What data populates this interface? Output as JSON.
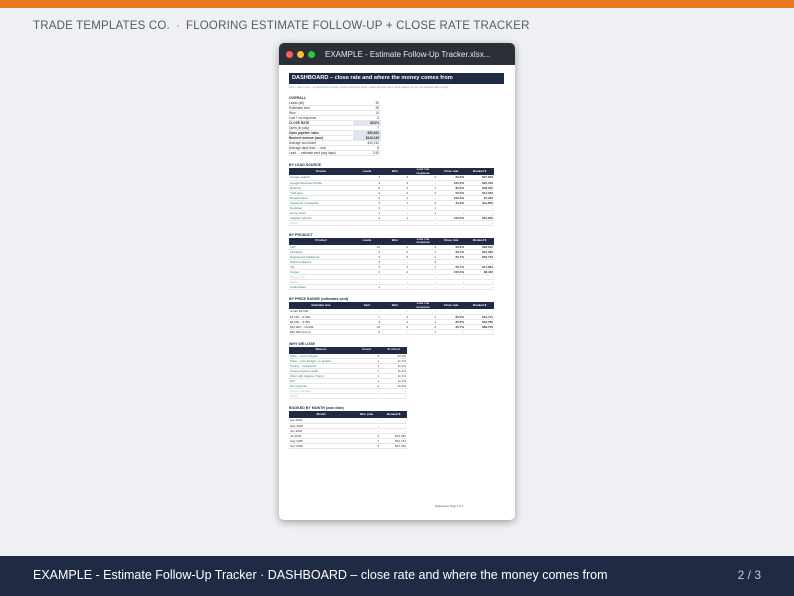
{
  "header": {
    "brand": "TRADE TEMPLATES CO.",
    "separator": "·",
    "product": "FLOORING ESTIMATE FOLLOW-UP + CLOSE RATE TRACKER"
  },
  "window": {
    "title": "EXAMPLE - Estimate Follow-Up Tracker.xlsx..."
  },
  "dashboard": {
    "title": "DASHBOARD – close rate and where the money comes from",
    "subtitle": "Won ÷ Sent ÷ lost ÷ no response by source, product and price range. Leads still open don't count against you yet. An estimate with no reply",
    "overall": {
      "title": "OVERALL",
      "rows": [
        {
          "label": "Leads (all)",
          "value": "30"
        },
        {
          "label": "Estimates sent",
          "value": "28"
        },
        {
          "label": "Won",
          "value": "14"
        },
        {
          "label": "Lost + no response",
          "value": "6"
        },
        {
          "label": "CLOSE RATE",
          "value": "60.0%"
        },
        {
          "label": "Open (in play)",
          "value": "7"
        },
        {
          "label": "Open pipeline value",
          "value": "$55,500"
        },
        {
          "label": "Booked revenue (won)",
          "value": "$143,245"
        },
        {
          "label": "Average won ticket",
          "value": "$10,232"
        },
        {
          "label": "Average days lead → won",
          "value": "8"
        },
        {
          "label": "Lead → estimate sent (avg days)",
          "value": "2.53"
        }
      ]
    },
    "by_source": {
      "title": "BY LEAD SOURCE",
      "headers": [
        "Source",
        "Leads",
        "Won",
        "Lost / no response",
        "Close rate",
        "Booked $"
      ],
      "rows": [
        [
          "Google search",
          "7",
          "3",
          "2",
          "60.0%",
          "$27,863"
        ],
        [
          "Google Business Profile",
          "3",
          "3",
          "-",
          "100.0%",
          "$22,160"
        ],
        [
          "Referral",
          "5",
          "4",
          "1",
          "80.0%",
          "$36,350"
        ],
        [
          "Yard sign",
          "4",
          "2",
          "2",
          "50.0%",
          "$14,932"
        ],
        [
          "Repeat client",
          "2",
          "1",
          "-",
          "100.0%",
          "$7,220"
        ],
        [
          "Facebook / Instagram",
          "3",
          "1",
          "2",
          "33.3%",
          "$11,850"
        ],
        [
          "Nextdoor",
          "3",
          "-",
          "1",
          "-",
          "-"
        ],
        [
          "Home show",
          "1",
          "-",
          "1",
          "-",
          "-"
        ],
        [
          "Supplier referral",
          "2",
          "1",
          "-",
          "100.0%",
          "$15,600"
        ],
        [
          "Other",
          "-",
          "-",
          "-",
          "-",
          "-"
        ]
      ]
    },
    "by_product": {
      "title": "BY PRODUCT",
      "headers": [
        "Product",
        "Leads",
        "Won",
        "Lost / no response",
        "Close rate",
        "Booked $"
      ],
      "rows": [
        [
          "LVP",
          "12",
          "6",
          "4",
          "60.0%",
          "$69,916"
        ],
        [
          "Laminate",
          "4",
          "2",
          "1",
          "66.7%",
          "$16,282"
        ],
        [
          "Engineered hardwood",
          "3",
          "2",
          "1",
          "66.7%",
          "$30,740"
        ],
        [
          "Solid hardwood",
          "3",
          "-",
          "2",
          "-",
          "-"
        ],
        [
          "Tile",
          "4",
          "2",
          "1",
          "66.7%",
          "$17,862"
        ],
        [
          "Carpet",
          "3",
          "2",
          "-",
          "100.0%",
          "$8,430"
        ],
        [
          "Sheet vinyl",
          "-",
          "-",
          "-",
          "-",
          "-"
        ],
        [
          "Mixed",
          "-",
          "-",
          "-",
          "-",
          "-"
        ],
        [
          "Unidentified",
          "1",
          "-",
          "-",
          "-",
          "-"
        ]
      ]
    },
    "by_price": {
      "title": "BY PRICE RANGE (estimates sent)",
      "headers": [
        "Estimate size",
        "Sent",
        "Won",
        "Lost / no response",
        "Close rate",
        "Booked $"
      ],
      "rows": [
        [
          "Under $3,000",
          "-",
          "-",
          "-",
          "-",
          "-"
        ],
        [
          "$3,000 – 5,999",
          "7",
          "4",
          "1",
          "80.0%",
          "$19,710"
        ],
        [
          "$6,000 – 9,999",
          "9",
          "4",
          "1",
          "80.0%",
          "$33,780"
        ],
        [
          "$10,000 – 19,999",
          "10",
          "6",
          "3",
          "66.7%",
          "$89,755"
        ],
        [
          "$20,000 and up",
          "2",
          "-",
          "1",
          "-",
          "-"
        ]
      ]
    },
    "why_lose": {
      "title": "WHY WE LOSE",
      "headers": [
        "Reason",
        "Count",
        "% of lost"
      ],
      "rows": [
        [
          "Price – went cheaper",
          "3",
          "33.3%"
        ],
        [
          "Price – over budget, no project",
          "1",
          "11.1%"
        ],
        [
          "Timing – postponed",
          "1",
          "11.1%"
        ],
        [
          "Chose big-box install",
          "1",
          "11.1%"
        ],
        [
          "Went with relative / friend",
          "1",
          "11.1%"
        ],
        [
          "DIY",
          "1",
          "11.1%"
        ],
        [
          "No response",
          "2",
          "22.2%"
        ],
        [
          "Scope changed",
          "-",
          "-"
        ],
        [
          "Other",
          "-",
          "-"
        ]
      ]
    },
    "by_month": {
      "title": "BOOKED BY MONTH (won date)",
      "headers": [
        "Month",
        "Won jobs",
        "Booked $"
      ],
      "rows": [
        [
          "Apr 2026",
          "-",
          "-"
        ],
        [
          "May 2026",
          "-",
          "-"
        ],
        [
          "Jun 2026",
          "-",
          "-"
        ],
        [
          "Jul 2026",
          "4",
          "$44,055"
        ],
        [
          "Aug 2026",
          "7",
          "$61,744"
        ],
        [
          "Sep 2026",
          "3",
          "$37,446"
        ]
      ]
    },
    "footer": "Dashboard  |  Page 2 of 3"
  },
  "caption": "EXAMPLE - Estimate Follow-Up Tracker · DASHBOARD – close rate and where the money comes from",
  "pagination": "2 / 3",
  "colors": {
    "accent": "#e8791f",
    "navy": "#1f2a44",
    "green_text": "#2d7b4f"
  }
}
